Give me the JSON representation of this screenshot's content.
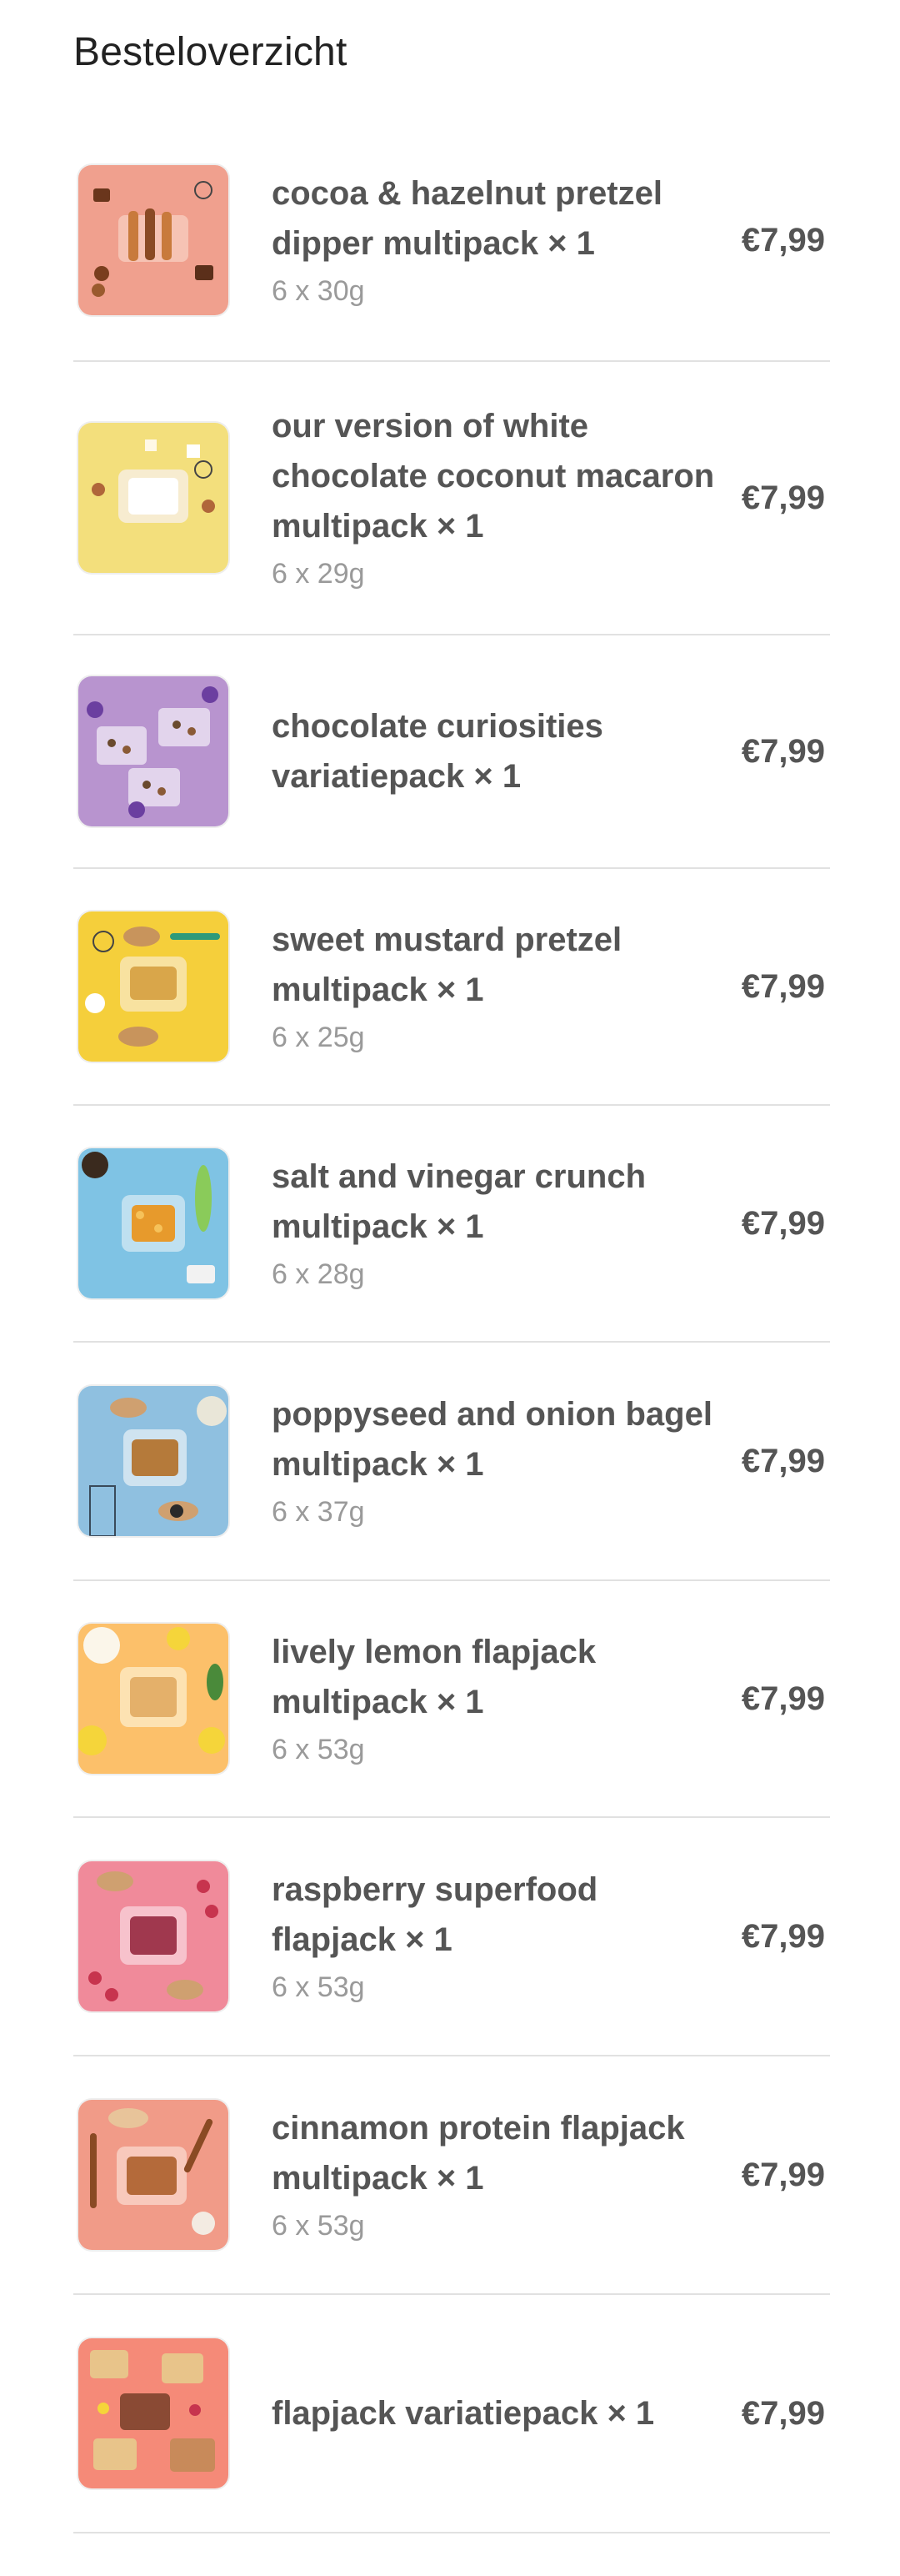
{
  "header": {
    "title": "Besteloverzicht"
  },
  "items": [
    {
      "name": "cocoa & hazelnut pretzel dipper multipack × 1",
      "variant": "6 x 30g",
      "price": "€7,99",
      "image_bg": "#f0a08e",
      "accent": "#c87a3c",
      "icon": "pretzel-dipper-image"
    },
    {
      "name": "our version of white chocolate coconut macaron multipack × 1",
      "variant": "6 x 29g",
      "price": "€7,99",
      "image_bg": "#f3df7c",
      "accent": "#ffffff",
      "icon": "coconut-macaron-image"
    },
    {
      "name": "chocolate curiosities variatiepack × 1",
      "variant": "",
      "price": "€7,99",
      "image_bg": "#b894cf",
      "accent": "#6a4a2e",
      "icon": "chocolate-variety-image"
    },
    {
      "name": "sweet mustard pretzel multipack × 1",
      "variant": "6 x 25g",
      "price": "€7,99",
      "image_bg": "#f5cf3b",
      "accent": "#d9a64a",
      "icon": "mustard-pretzel-image"
    },
    {
      "name": "salt and vinegar crunch multipack × 1",
      "variant": "6 x 28g",
      "price": "€7,99",
      "image_bg": "#7fc3e4",
      "accent": "#e79a2c",
      "icon": "salt-vinegar-image"
    },
    {
      "name": "poppyseed and onion bagel multipack × 1",
      "variant": "6 x 37g",
      "price": "€7,99",
      "image_bg": "#8fc0e0",
      "accent": "#b57a3a",
      "icon": "poppyseed-bagel-image"
    },
    {
      "name": "lively lemon flapjack multipack × 1",
      "variant": "6 x 53g",
      "price": "€7,99",
      "image_bg": "#fcc06a",
      "accent": "#f5d53a",
      "icon": "lemon-flapjack-image"
    },
    {
      "name": "raspberry superfood flapjack × 1",
      "variant": "6 x 53g",
      "price": "€7,99",
      "image_bg": "#f08a9a",
      "accent": "#c7344e",
      "icon": "raspberry-flapjack-image"
    },
    {
      "name": "cinnamon protein flapjack multipack × 1",
      "variant": "6 x 53g",
      "price": "€7,99",
      "image_bg": "#f19b88",
      "accent": "#b46a3a",
      "icon": "cinnamon-flapjack-image"
    },
    {
      "name": "flapjack variatiepack × 1",
      "variant": "",
      "price": "€7,99",
      "image_bg": "#f58a78",
      "accent": "#a86a38",
      "icon": "flapjack-variety-image"
    }
  ]
}
